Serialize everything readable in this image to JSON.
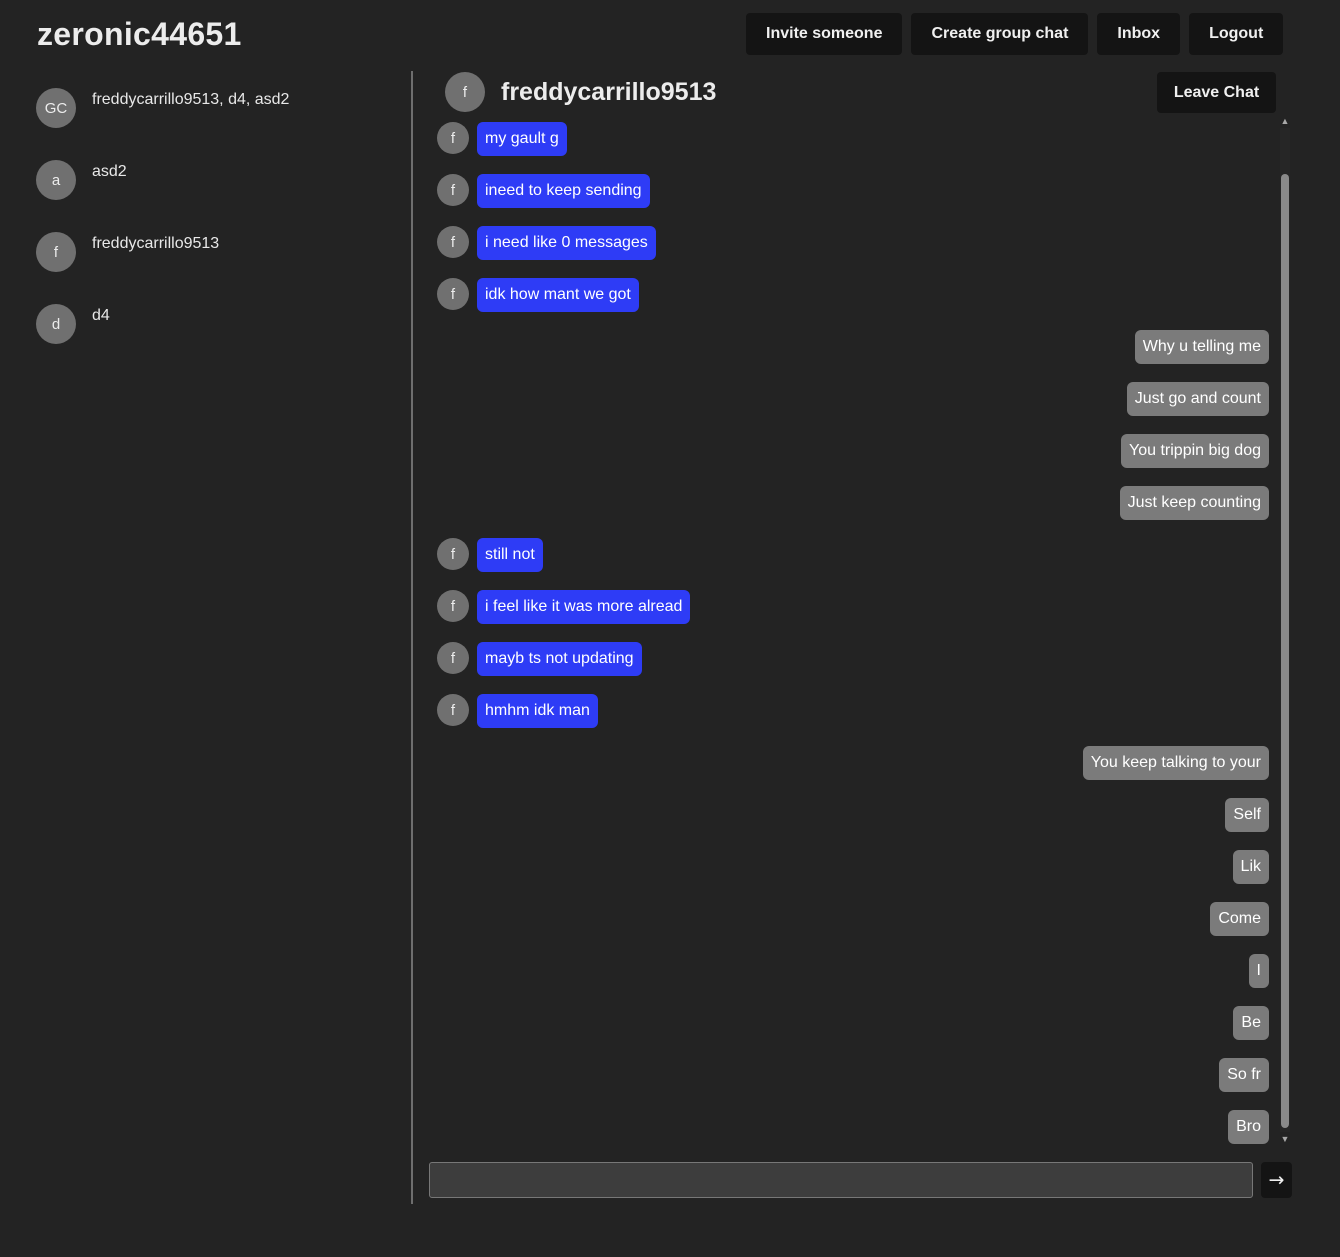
{
  "header": {
    "username": "zeronic44651",
    "nav": [
      "Invite someone",
      "Create group chat",
      "Inbox",
      "Logout"
    ]
  },
  "sidebar": {
    "conversations": [
      {
        "avatar": "GC",
        "label": "freddycarrillo9513, d4, asd2"
      },
      {
        "avatar": "a",
        "label": "asd2"
      },
      {
        "avatar": "f",
        "label": "freddycarrillo9513"
      },
      {
        "avatar": "d",
        "label": "d4"
      }
    ]
  },
  "chat": {
    "avatar": "f",
    "title": "freddycarrillo9513",
    "leave_label": "Leave Chat",
    "messages": [
      {
        "dir": "in",
        "avatar": "f",
        "text": "my gault g"
      },
      {
        "dir": "in",
        "avatar": "f",
        "text": "ineed to keep sending"
      },
      {
        "dir": "in",
        "avatar": "f",
        "text": "i need like 0 messages"
      },
      {
        "dir": "in",
        "avatar": "f",
        "text": "idk how mant we got"
      },
      {
        "dir": "out",
        "text": "Why u telling me"
      },
      {
        "dir": "out",
        "text": "Just go and count"
      },
      {
        "dir": "out",
        "text": "You trippin big dog"
      },
      {
        "dir": "out",
        "text": "Just keep counting"
      },
      {
        "dir": "in",
        "avatar": "f",
        "text": "still not"
      },
      {
        "dir": "in",
        "avatar": "f",
        "text": "i feel like it was more alread"
      },
      {
        "dir": "in",
        "avatar": "f",
        "text": "mayb ts not updating"
      },
      {
        "dir": "in",
        "avatar": "f",
        "text": "hmhm idk man"
      },
      {
        "dir": "out",
        "text": "You keep talking to your"
      },
      {
        "dir": "out",
        "text": "Self"
      },
      {
        "dir": "out",
        "text": "Lik"
      },
      {
        "dir": "out",
        "text": "Come"
      },
      {
        "dir": "out",
        "text": "I"
      },
      {
        "dir": "out",
        "text": "Be"
      },
      {
        "dir": "out",
        "text": "So fr"
      },
      {
        "dir": "out",
        "text": "Bro"
      }
    ],
    "composer": {
      "value": "",
      "placeholder": ""
    },
    "send_icon": "→"
  },
  "colors": {
    "background": "#232323",
    "incoming_bubble": "#2e3cf6",
    "outgoing_bubble": "#7b7b7b",
    "button": "#141414",
    "avatar": "#707070"
  }
}
